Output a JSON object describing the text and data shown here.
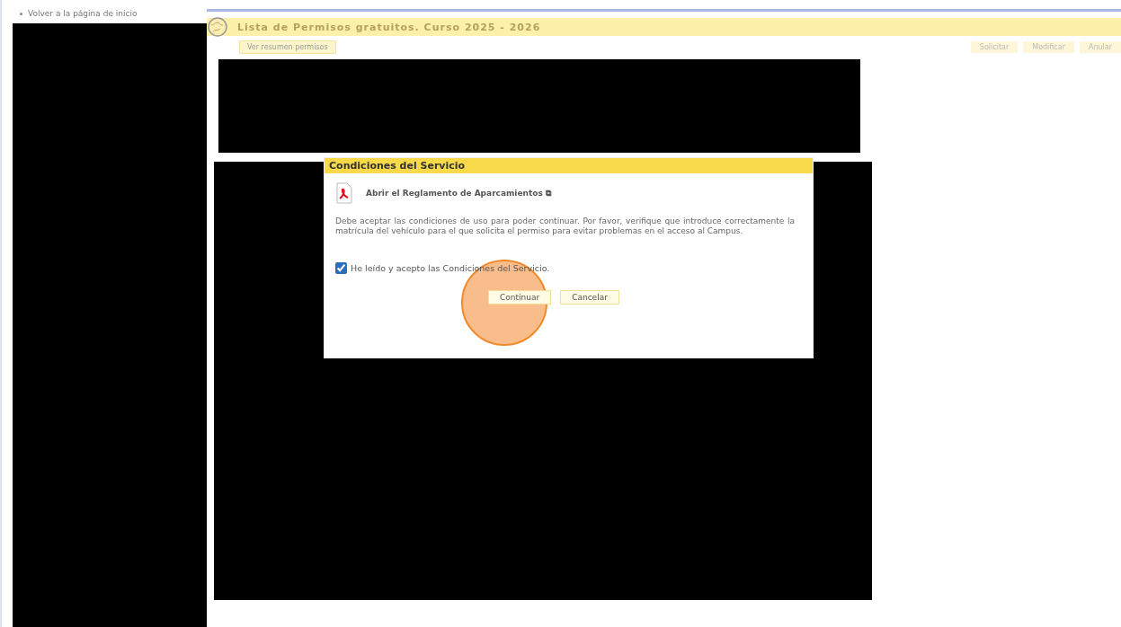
{
  "sidebar": {
    "link": "Volver a la página de inicio"
  },
  "header": {
    "title": "Lista de Permisos gratuitos. Curso 2025 - 2026",
    "tab": "Ver resumen permisos"
  },
  "toolbar": {
    "buttons": [
      {
        "label": "Solicitar"
      },
      {
        "label": "Modificar"
      },
      {
        "label": "Anular"
      }
    ]
  },
  "dialog": {
    "title": "Condiciones del Servicio",
    "link": "Abrir el Reglamento de Aparcamientos ⧉",
    "message": "Debe aceptar las condiciones de uso para poder continuar. Por favor, verifique que introduce correctamente la matrícula del vehículo para el que solicita el permiso para evitar problemas en el acceso al Campus.",
    "checkbox": {
      "label": "He leído y acepto las Condiciones del Servicio.",
      "checked": true
    },
    "buttons": [
      {
        "label": "Continuar",
        "highlighted": true
      },
      {
        "label": "Cancelar",
        "highlighted": false
      }
    ]
  }
}
